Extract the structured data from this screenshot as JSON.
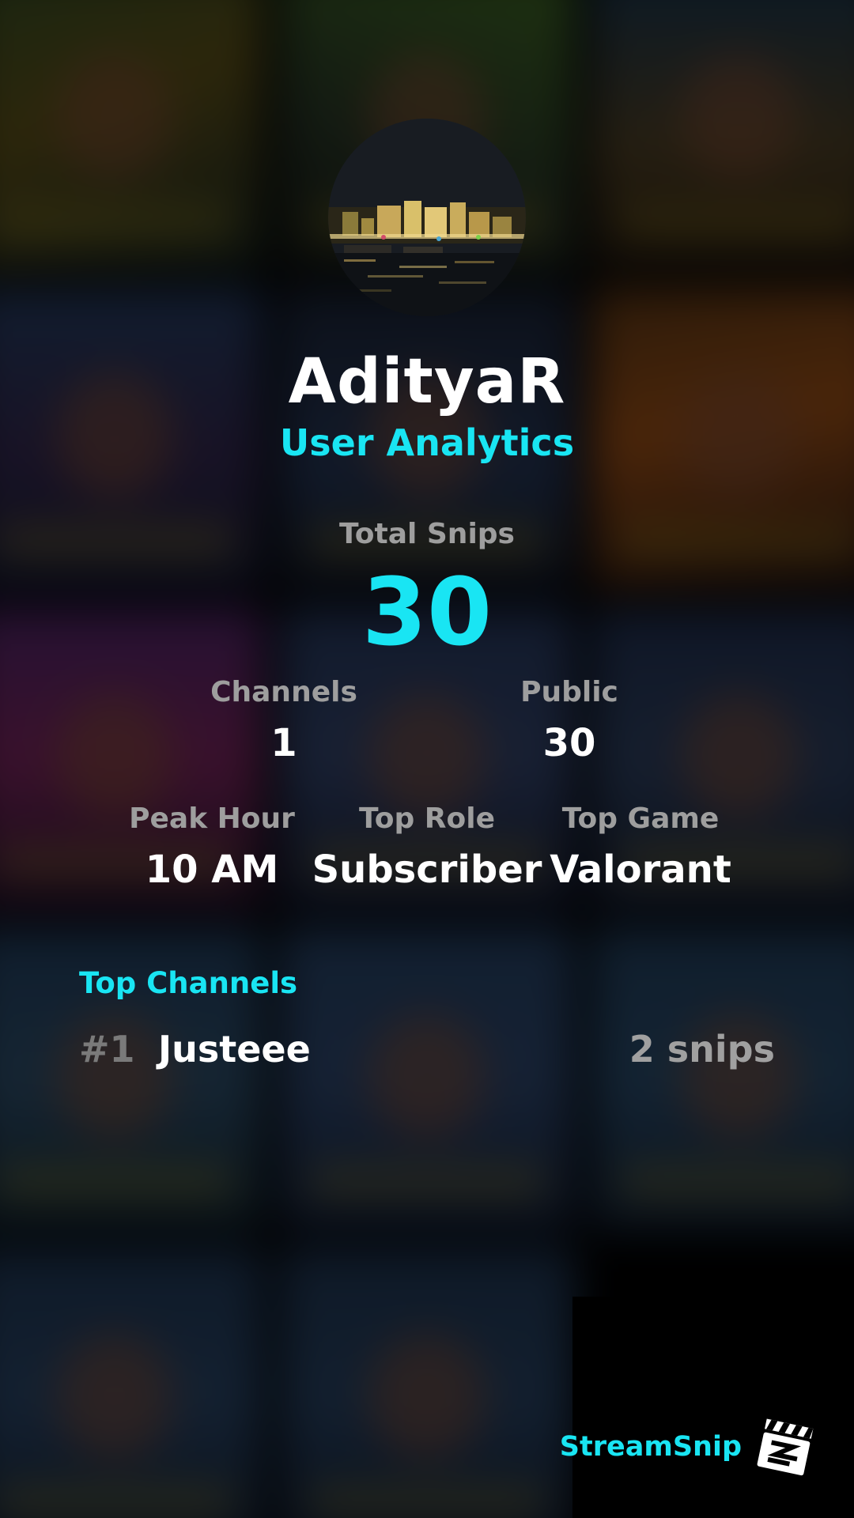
{
  "profile": {
    "username": "AdityaR",
    "subtitle": "User Analytics"
  },
  "stats": {
    "total_snips_label": "Total Snips",
    "total_snips_value": "30",
    "channels_label": "Channels",
    "channels_value": "1",
    "public_label": "Public",
    "public_value": "30",
    "peak_hour_label": "Peak Hour",
    "peak_hour_value": "10 AM",
    "top_role_label": "Top Role",
    "top_role_value": "Subscriber",
    "top_game_label": "Top Game",
    "top_game_value": "Valorant"
  },
  "top_channels": {
    "title": "Top Channels",
    "items": [
      {
        "rank": "#1",
        "name": "Justeee",
        "count": "2 snips"
      }
    ]
  },
  "brand": {
    "name": "StreamSnip",
    "icon": "clapperboard-icon"
  },
  "colors": {
    "accent": "#19e5f3",
    "label_gray": "#9e9e9e",
    "background": "#050608"
  }
}
